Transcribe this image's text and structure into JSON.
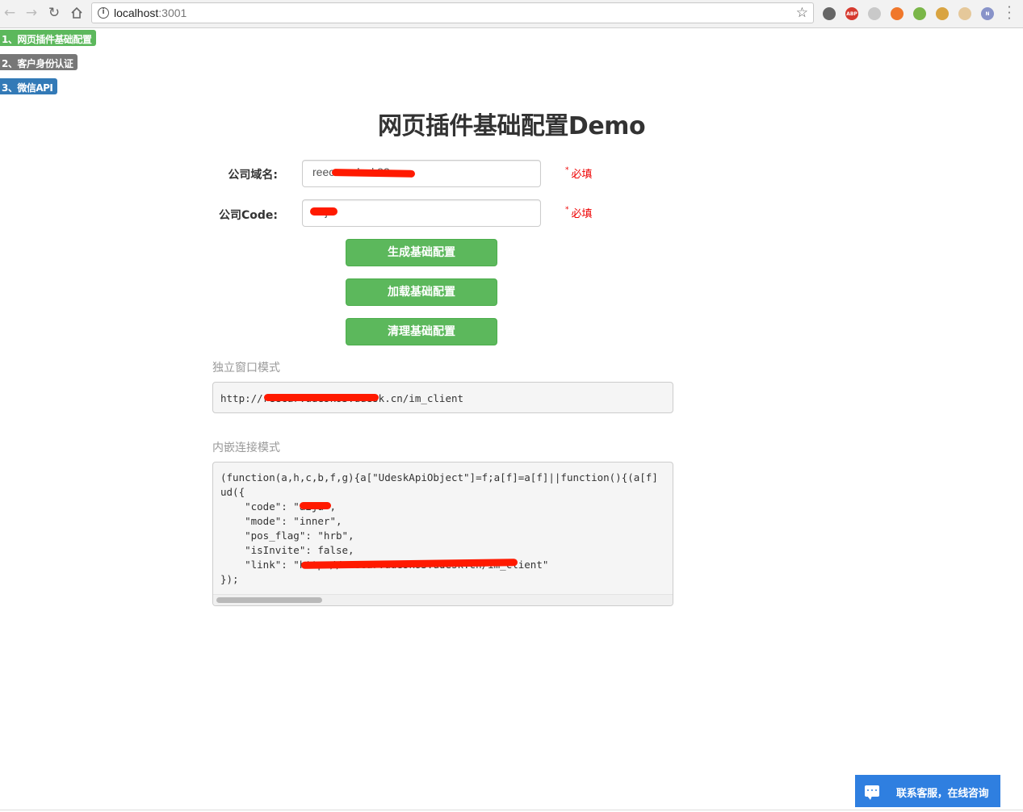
{
  "browser": {
    "url_host": "localhost",
    "url_port": ":3001",
    "back_icon": "arrow-left-icon",
    "forward_icon": "arrow-right-icon",
    "reload_icon": "reload-icon",
    "home_icon": "home-icon",
    "extensions": [
      {
        "name": "puzzle-extension-icon",
        "color": "#666666",
        "label": ""
      },
      {
        "name": "adblock-extension-icon",
        "color": "#d63a2f",
        "label": "ABP"
      },
      {
        "name": "extension-icon-3",
        "color": "#c9c9c9",
        "label": ""
      },
      {
        "name": "extension-icon-4",
        "color": "#f0772b",
        "label": ""
      },
      {
        "name": "extension-icon-5",
        "color": "#7ab648",
        "label": ""
      },
      {
        "name": "cookie-extension-icon",
        "color": "#d9a441",
        "label": ""
      },
      {
        "name": "cookie-extension-icon-2",
        "color": "#e5c89a",
        "label": ""
      },
      {
        "name": "extension-icon-8",
        "color": "#8893c9",
        "label": "N"
      }
    ]
  },
  "side_nav": [
    {
      "label": "1、网页插件基础配置",
      "color": "#5cb85c"
    },
    {
      "label": "2、客户身份认证",
      "color": "#777777"
    },
    {
      "label": "3、微信API",
      "color": "#337ab7"
    }
  ],
  "title": "网页插件基础配置Demo",
  "form": {
    "domain_label": "公司域名:",
    "domain_value": "reecar.udesk83",
    "code_label": "公司Code:",
    "code_value": "a2ja",
    "required_text": "必填"
  },
  "buttons": {
    "generate": "生成基础配置",
    "load": "加载基础配置",
    "clear": "清理基础配置"
  },
  "standalone": {
    "label": "独立窗口模式",
    "url": "http://reecar.udesk83.udesk.cn/im_client"
  },
  "embedded": {
    "label": "内嵌连接模式",
    "code_lines": [
      "(function(a,h,c,b,f,g){a[\"UdeskApiObject\"]=f;a[f]=a[f]||function(){(a[f]",
      "ud({",
      "    \"code\": \"a2ja\",",
      "    \"mode\": \"inner\",",
      "    \"pos_flag\": \"hrb\",",
      "    \"isInvite\": false,",
      "    \"link\": \"http://reecar.udesk83.udesk.cn/im_client\"",
      "});"
    ]
  },
  "chat_widget": {
    "label": "联系客服，在线咨询",
    "icon": "chat-bubble-icon",
    "color": "#2f7fe0"
  },
  "colors": {
    "success": "#5cb85c",
    "required": "#ee0000",
    "primary": "#337ab7"
  }
}
